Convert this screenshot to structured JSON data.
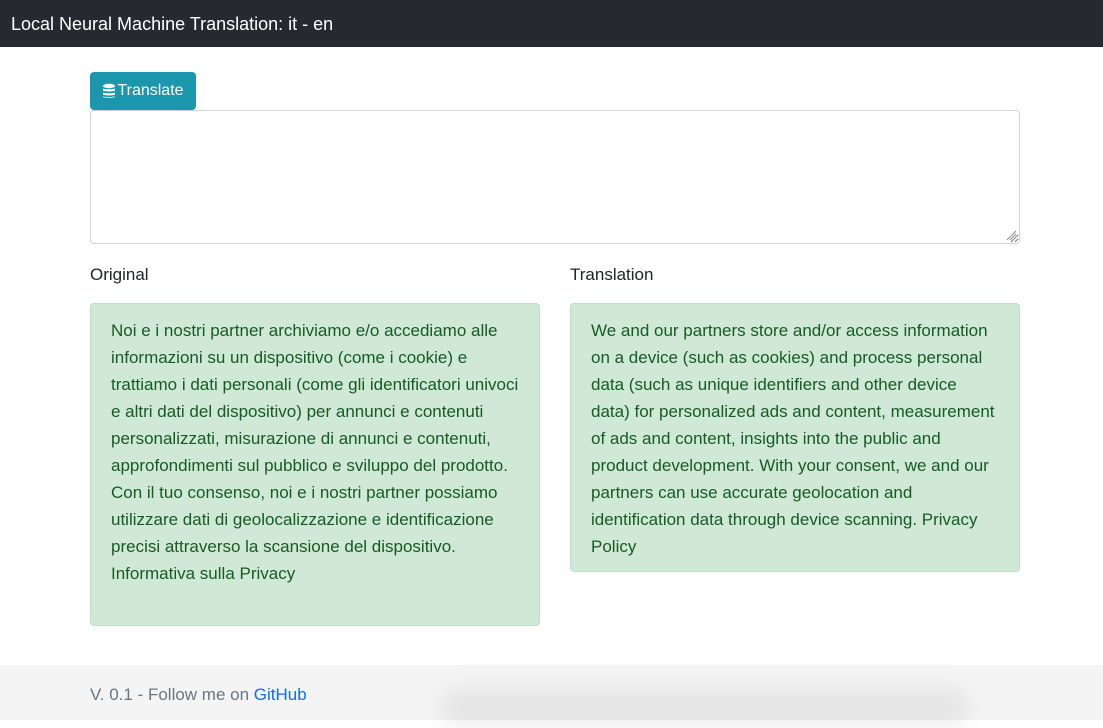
{
  "navbar": {
    "title": "Local Neural Machine Translation: it - en"
  },
  "toolbar": {
    "translate_label": "Translate",
    "translate_icon": "database-icon"
  },
  "input": {
    "value": "",
    "placeholder": ""
  },
  "columns": {
    "original_label": "Original",
    "translation_label": "Translation"
  },
  "results": {
    "original_text": "Noi e i nostri partner archiviamo e/o accediamo alle informazioni su un dispositivo (come i cookie) e trattiamo i dati personali (come gli identificatori univoci e altri dati del dispositivo) per annunci e contenuti personalizzati, misurazione di annunci e contenuti, approfondimenti sul pubblico e sviluppo del prodotto. Con il tuo consenso, noi e i nostri partner possiamo utilizzare dati di geolocalizzazione e identificazione precisi attraverso la scansione del dispositivo. Informativa sulla Privacy",
    "translation_text": "We and our partners store and/or access information on a device (such as cookies) and process personal data (such as unique identifiers and other device data) for personalized ads and content, measurement of ads and content, insights into the public and product development. With your consent, we and our partners can use accurate geolocation and identification data through device scanning. Privacy Policy"
  },
  "footer": {
    "version_text": "V. 0.1 - Follow me on ",
    "link_label": "GitHub"
  },
  "colors": {
    "navbar_bg": "#262a2e",
    "button_bg": "#1b97ad",
    "alert_bg": "#cfe9d6",
    "alert_text": "#165a24",
    "link": "#0b6efd",
    "footer_bg": "#f4f4f4"
  }
}
